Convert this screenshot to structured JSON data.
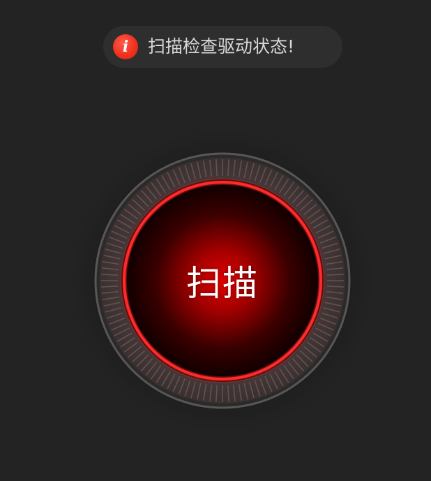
{
  "notice": {
    "icon": "info-icon",
    "icon_glyph": "i",
    "message": "扫描检查驱动状态!"
  },
  "scan_button": {
    "label": "扫描"
  },
  "colors": {
    "background": "#232323",
    "notice_background": "#2e2e2e",
    "info_icon": "#f0321f",
    "accent_ring": "#ff2a2a",
    "button_core": "#cc0000"
  }
}
